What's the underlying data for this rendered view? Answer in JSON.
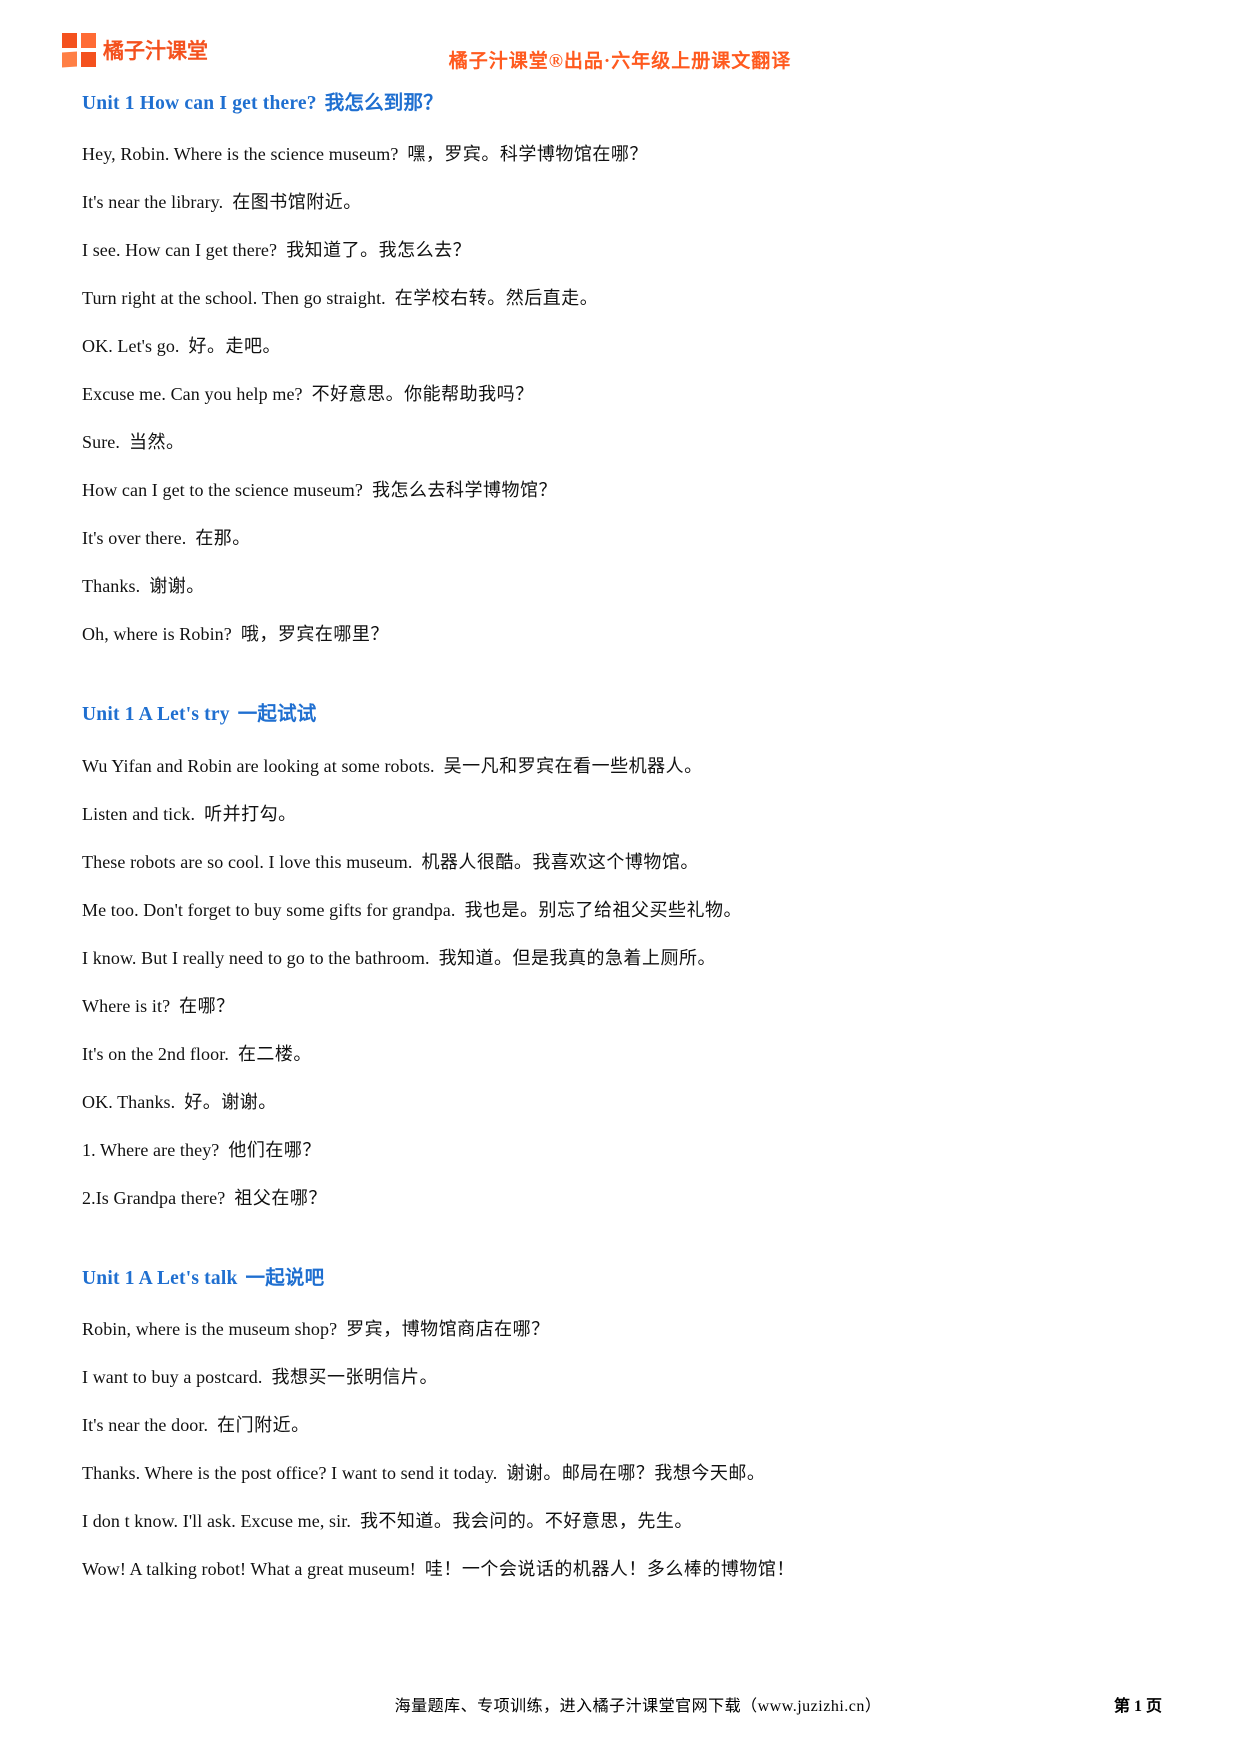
{
  "header": {
    "brand_name": "橘子汁课堂",
    "title": "橘子汁课堂®出品·六年级上册课文翻译",
    "brand_color": "#f4511e",
    "title_color": "#ff5a1f"
  },
  "heading_color": "#1f6fd0",
  "sections": [
    {
      "heading_en": "Unit 1 How can I get there?",
      "heading_cn": "我怎么到那？",
      "lines": [
        {
          "en": "Hey, Robin. Where is the science museum?",
          "cn": "嘿，罗宾。科学博物馆在哪？"
        },
        {
          "en": "It's near the library.",
          "cn": "在图书馆附近。"
        },
        {
          "en": "I see. How can I get there?",
          "cn": "我知道了。我怎么去？"
        },
        {
          "en": "Turn right at the school. Then go straight.",
          "cn": "在学校右转。然后直走。"
        },
        {
          "en": "OK. Let's go.",
          "cn": "好。走吧。"
        },
        {
          "en": "Excuse me. Can you help me?",
          "cn": "不好意思。你能帮助我吗？"
        },
        {
          "en": "Sure.",
          "cn": "当然。"
        },
        {
          "en": "How can I get to the science museum?",
          "cn": "我怎么去科学博物馆？"
        },
        {
          "en": "It's over there.",
          "cn": "在那。"
        },
        {
          "en": "Thanks.",
          "cn": "谢谢。"
        },
        {
          "en": "Oh, where is Robin?",
          "cn": "哦，罗宾在哪里？"
        }
      ]
    },
    {
      "heading_en": "Unit 1 A Let's try",
      "heading_cn": "一起试试",
      "lines": [
        {
          "en": "Wu Yifan and Robin are looking at some robots.",
          "cn": "吴一凡和罗宾在看一些机器人。"
        },
        {
          "en": "Listen and tick.",
          "cn": "听并打勾。"
        },
        {
          "en": "These robots are so cool. I love this museum.",
          "cn": "机器人很酷。我喜欢这个博物馆。"
        },
        {
          "en": "Me too. Don't forget to buy some gifts for grandpa.",
          "cn": "我也是。别忘了给祖父买些礼物。"
        },
        {
          "en": "I know. But I really need to go to the bathroom.",
          "cn": "我知道。但是我真的急着上厕所。"
        },
        {
          "en": "Where is it?",
          "cn": "在哪？"
        },
        {
          "en": "It's on the 2nd floor.",
          "cn": "在二楼。"
        },
        {
          "en": "OK. Thanks.",
          "cn": "好。谢谢。"
        },
        {
          "en": "1. Where are they?",
          "cn": "他们在哪？"
        },
        {
          "en": "2.Is Grandpa there?",
          "cn": "祖父在哪？"
        }
      ]
    },
    {
      "heading_en": "Unit 1 A Let's talk",
      "heading_cn": "一起说吧",
      "lines": [
        {
          "en": "Robin, where is the museum shop?",
          "cn": "罗宾，博物馆商店在哪？"
        },
        {
          "en": "I want to buy a postcard.",
          "cn": "我想买一张明信片。"
        },
        {
          "en": "It's near the door.",
          "cn": "在门附近。"
        },
        {
          "en": "Thanks. Where is the post office? I want to send it today.",
          "cn": "谢谢。邮局在哪？我想今天邮。"
        },
        {
          "en": "I don t know. I'll ask. Excuse me, sir.",
          "cn": "我不知道。我会问的。不好意思，先生。"
        },
        {
          "en": "Wow! A talking robot! What a great museum!",
          "cn": "哇！一个会说话的机器人！多么棒的博物馆！"
        }
      ]
    }
  ],
  "footer": {
    "note": "海量题库、专项训练，进入橘子汁课堂官网下载（www.juzizhi.cn）",
    "page": "第 1 页"
  }
}
